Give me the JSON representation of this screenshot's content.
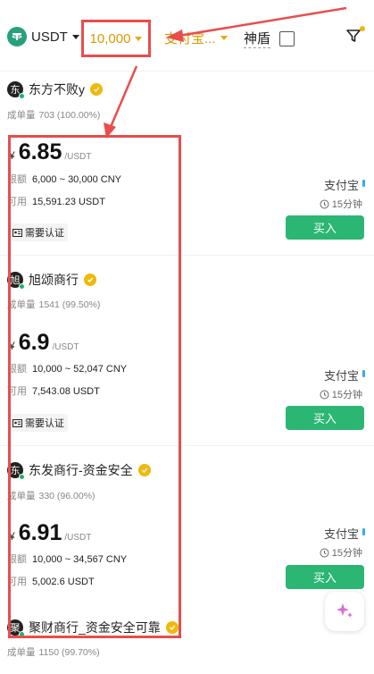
{
  "topbar": {
    "coin": "USDT",
    "amount": "10,000",
    "payment_filter": "支付宝...",
    "shield_label": "神盾"
  },
  "merchants": [
    {
      "name": "东方不败y",
      "avatar_char": "东",
      "stats_label": "成单量",
      "stats_value": "703 (100.00%)",
      "currency_symbol": "¥",
      "price": "6.85",
      "price_unit": "/USDT",
      "limit_label": "限额",
      "limit_value": "6,000 ~ 30,000 CNY",
      "available_label": "可用",
      "available_value": "15,591.23 USDT",
      "badge": "需要认证",
      "pay_method": "支付宝",
      "timer": "15分钟",
      "buy_label": "买入"
    },
    {
      "name": "旭颂商行",
      "avatar_char": "旭",
      "stats_label": "成单量",
      "stats_value": "1541 (99.50%)",
      "currency_symbol": "¥",
      "price": "6.9",
      "price_unit": "/USDT",
      "limit_label": "限额",
      "limit_value": "10,000 ~ 52,047 CNY",
      "available_label": "可用",
      "available_value": "7,543.08 USDT",
      "badge": "需要认证",
      "pay_method": "支付宝",
      "timer": "15分钟",
      "buy_label": "买入"
    },
    {
      "name": "东发商行-资金安全",
      "avatar_char": "东",
      "stats_label": "成单量",
      "stats_value": "330 (96.00%)",
      "currency_symbol": "¥",
      "price": "6.91",
      "price_unit": "/USDT",
      "limit_label": "限额",
      "limit_value": "10,000 ~ 34,567 CNY",
      "available_label": "可用",
      "available_value": "5,002.6 USDT",
      "badge": "",
      "pay_method": "支付宝",
      "timer": "15分钟",
      "buy_label": "买入"
    },
    {
      "name": "聚财商行_资金安全可靠",
      "avatar_char": "聚",
      "stats_label": "成单量",
      "stats_value": "1150 (99.70%)"
    }
  ],
  "colors": {
    "accent_gold": "#d99a00",
    "buy_green": "#2bb673",
    "annotation_red": "#e84d4d"
  }
}
